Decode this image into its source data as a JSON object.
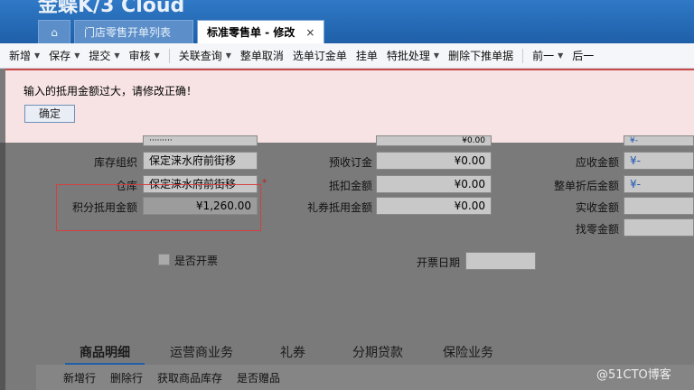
{
  "header": {
    "brand": "金蝶K/3 Cloud",
    "tabs": [
      {
        "icon": "home-icon"
      },
      {
        "label": "门店零售开单列表"
      },
      {
        "label": "标准零售单 - 修改",
        "close": "×"
      }
    ]
  },
  "toolbar": {
    "items": [
      "新增",
      "保存",
      "提交",
      "审核",
      "关联查询",
      "整单取消",
      "选单订金单",
      "挂单",
      "特批处理",
      "删除下推单据",
      "前一",
      "后一"
    ]
  },
  "dialog": {
    "message": "输入的抵用金额过大，请修改正确！",
    "ok_label": "确定"
  },
  "form": {
    "top_values": {
      "c1": "·········",
      "c2": "¥0.00",
      "c3": "¥-"
    },
    "left": {
      "stock_org_label": "库存组织",
      "stock_org_value": "保定涞水府前街移",
      "warehouse_label": "仓库",
      "warehouse_value": "保定涞水府前街移",
      "points_label": "积分抵用金额",
      "points_value": "¥1,260.00",
      "invoice_label": "是否开票"
    },
    "middle": {
      "prepaid_label": "预收订金",
      "prepaid_value": "¥0.00",
      "deduct_label": "抵扣金额",
      "deduct_value": "¥0.00",
      "voucher_label": "礼券抵用金额",
      "voucher_value": "¥0.00",
      "invoice_date_label": "开票日期"
    },
    "right": {
      "receivable_label": "应收金额",
      "receivable_value": "¥-",
      "after_discount_label": "整单折后金额",
      "after_discount_value": "¥-",
      "received_label": "实收金额",
      "change_label": "找零金额"
    }
  },
  "bottom_tabs": [
    "商品明细",
    "运营商业务",
    "礼券",
    "分期贷款",
    "保险业务"
  ],
  "subtoolbar": [
    "新增行",
    "删除行",
    "获取商品库存",
    "是否赠品"
  ],
  "watermark": "@51CTO博客"
}
